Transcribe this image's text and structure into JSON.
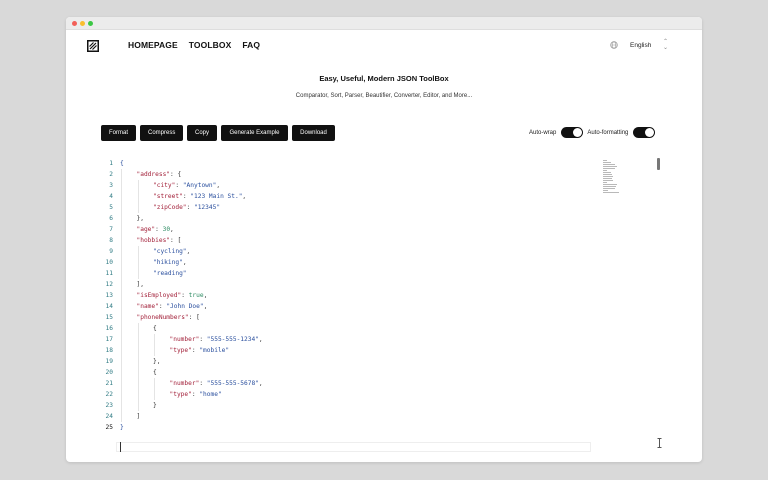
{
  "nav": {
    "items": [
      "HOMEPAGE",
      "TOOLBOX",
      "FAQ"
    ]
  },
  "language": {
    "selected": "English"
  },
  "header": {
    "title": "Easy, Useful, Modern JSON ToolBox",
    "subtitle": "Comparator, Sort, Parser, Beautifier, Converter, Editor, and More..."
  },
  "toolbar": {
    "format_label": "Format",
    "compress_label": "Compress",
    "copy_label": "Copy",
    "generate_label": "Generate Example",
    "download_label": "Download"
  },
  "toggles": {
    "auto_wrap": {
      "label": "Auto-wrap",
      "on": true
    },
    "auto_formatting": {
      "label": "Auto-formatting",
      "on": true
    }
  },
  "editor": {
    "line_numbers": [
      "1",
      "2",
      "3",
      "4",
      "5",
      "6",
      "7",
      "8",
      "9",
      "10",
      "11",
      "12",
      "13",
      "14",
      "15",
      "16",
      "17",
      "18",
      "19",
      "20",
      "21",
      "22",
      "23",
      "24",
      "25"
    ],
    "active_line": "25",
    "lines": [
      [
        [
          "{",
          "b"
        ]
      ],
      [
        [
          "\"address\"",
          "k"
        ],
        [
          ": {",
          "p"
        ]
      ],
      [
        [
          "\"city\"",
          "k"
        ],
        [
          ": ",
          "p"
        ],
        [
          "\"Anytown\"",
          "s"
        ],
        [
          ",",
          "p"
        ]
      ],
      [
        [
          "\"street\"",
          "k"
        ],
        [
          ": ",
          "p"
        ],
        [
          "\"123 Main St.\"",
          "s"
        ],
        [
          ",",
          "p"
        ]
      ],
      [
        [
          "\"zipCode\"",
          "k"
        ],
        [
          ": ",
          "p"
        ],
        [
          "\"12345\"",
          "s"
        ]
      ],
      [
        [
          "},",
          "p"
        ]
      ],
      [
        [
          "\"age\"",
          "k"
        ],
        [
          ": ",
          "p"
        ],
        [
          "30",
          "n"
        ],
        [
          ",",
          "p"
        ]
      ],
      [
        [
          "\"hobbies\"",
          "k"
        ],
        [
          ": [",
          "p"
        ]
      ],
      [
        [
          "\"cycling\"",
          "s"
        ],
        [
          ",",
          "p"
        ]
      ],
      [
        [
          "\"hiking\"",
          "s"
        ],
        [
          ",",
          "p"
        ]
      ],
      [
        [
          "\"reading\"",
          "s"
        ]
      ],
      [
        [
          "],",
          "p"
        ]
      ],
      [
        [
          "\"isEmployed\"",
          "k"
        ],
        [
          ": ",
          "p"
        ],
        [
          "true",
          "n"
        ],
        [
          ",",
          "p"
        ]
      ],
      [
        [
          "\"name\"",
          "k"
        ],
        [
          ": ",
          "p"
        ],
        [
          "\"John Doe\"",
          "s"
        ],
        [
          ",",
          "p"
        ]
      ],
      [
        [
          "\"phoneNumbers\"",
          "k"
        ],
        [
          ": [",
          "p"
        ]
      ],
      [
        [
          "{",
          "p"
        ]
      ],
      [
        [
          "\"number\"",
          "k"
        ],
        [
          ": ",
          "p"
        ],
        [
          "\"555-555-1234\"",
          "s"
        ],
        [
          ",",
          "p"
        ]
      ],
      [
        [
          "\"type\"",
          "k"
        ],
        [
          ": ",
          "p"
        ],
        [
          "\"mobile\"",
          "s"
        ]
      ],
      [
        [
          "},",
          "p"
        ]
      ],
      [
        [
          "{",
          "p"
        ]
      ],
      [
        [
          "\"number\"",
          "k"
        ],
        [
          ": ",
          "p"
        ],
        [
          "\"555-555-5678\"",
          "s"
        ],
        [
          ",",
          "p"
        ]
      ],
      [
        [
          "\"type\"",
          "k"
        ],
        [
          ": ",
          "p"
        ],
        [
          "\"home\"",
          "s"
        ]
      ],
      [
        [
          "}",
          "p"
        ]
      ],
      [
        [
          "]",
          "p"
        ]
      ],
      [
        [
          "}",
          "b"
        ]
      ]
    ]
  },
  "colors": {
    "accent": "#111111",
    "key": "#a3213a",
    "string": "#2a4f9e",
    "number": "#2c8b62",
    "line_number": "#2f7b84"
  }
}
